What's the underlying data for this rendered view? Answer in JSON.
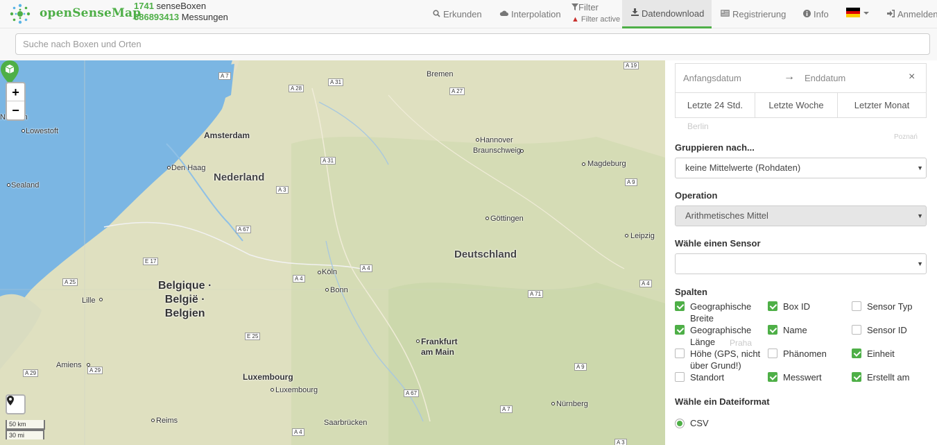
{
  "brand": {
    "name": "openSenseMap"
  },
  "stats": {
    "boxes_count": "1741",
    "boxes_label": "senseBoxen",
    "measurements_count": "886893413",
    "measurements_label": "Messungen"
  },
  "nav": {
    "explore": "Erkunden",
    "interpolation": "Interpolation",
    "filter": "Filter",
    "filter_status": "Filter active",
    "download": "Datendownload",
    "register": "Registrierung",
    "info": "Info",
    "login": "Anmelden"
  },
  "search": {
    "placeholder": "Suche nach Boxen und Orten"
  },
  "map": {
    "places": {
      "bremen": "Bremen",
      "hannover": "Hannover",
      "braunschweig": "Braunschweig",
      "magdeburg": "Magdeburg",
      "amsterdam": "Amsterdam",
      "den_haag": "Den Haag",
      "lowestoft": "Lowestoft",
      "norwich": "Norwich",
      "sealand": "Sealand",
      "goettingen": "Göttingen",
      "leipzig": "Leipzig",
      "koeln": "Köln",
      "bonn": "Bonn",
      "lille": "Lille",
      "amiens": "Amiens",
      "frankfurt_1": "Frankfurt",
      "frankfurt_2": "am Main",
      "luxembourg_country": "Luxembourg",
      "luxembourg_city": "Luxembourg",
      "nuernberg": "Nürnberg",
      "reims": "Reims",
      "saarbruecken": "Saarbrücken",
      "nederland": "Nederland",
      "deutschland": "Deutschland",
      "belgium_1": "Belgique ·",
      "belgium_2": "België ·",
      "belgium_3": "Belgien"
    },
    "roads": {
      "a7": "A 7",
      "a28": "A 28",
      "a31a": "A 31",
      "a27": "A 27",
      "a19": "A 19",
      "a31b": "A 31",
      "a3": "A 3",
      "a67": "A 67",
      "a9a": "A 9",
      "e17": "E 17",
      "a25": "A 25",
      "a4a": "A 4",
      "a4b": "A 4",
      "a71": "A 71",
      "a4c": "A 4",
      "e25": "E 25",
      "a29a": "A 29",
      "a29b": "A 29",
      "a67b": "A 67",
      "a9b": "A 9",
      "a7b": "A 7",
      "a4d": "A 4",
      "a3b": "A 3"
    },
    "zoom_in": "+",
    "zoom_out": "−",
    "scale_metric": "50 km",
    "scale_imperial": "30 mi"
  },
  "panel": {
    "start_date_placeholder": "Anfangsdatum",
    "end_date_placeholder": "Enddatum",
    "arrow": "→",
    "close": "×",
    "quick": [
      "Letzte 24 Std.",
      "Letzte Woche",
      "Letzter Monat"
    ],
    "group_label": "Gruppieren nach...",
    "group_value": "keine Mittelwerte (Rohdaten)",
    "operation_label": "Operation",
    "operation_value": "Arithmetisches Mittel",
    "sensor_label": "Wähle einen Sensor",
    "sensor_value": "",
    "columns_label": "Spalten",
    "columns": [
      {
        "label": "Geographische Breite",
        "checked": true
      },
      {
        "label": "Box ID",
        "checked": true
      },
      {
        "label": "Sensor Typ",
        "checked": false
      },
      {
        "label": "Geographische Länge",
        "checked": true
      },
      {
        "label": "Name",
        "checked": true
      },
      {
        "label": "Sensor ID",
        "checked": false
      },
      {
        "label": "Höhe (GPS, nicht über Grund!)",
        "checked": false
      },
      {
        "label": "Phänomen",
        "checked": false
      },
      {
        "label": "Einheit",
        "checked": true
      },
      {
        "label": "Standort",
        "checked": false
      },
      {
        "label": "Messwert",
        "checked": true
      },
      {
        "label": "Erstellt am",
        "checked": true
      }
    ],
    "format_label": "Wähle ein Dateiformat",
    "format_value": "CSV",
    "bg_labels": {
      "berlin": "Berlin",
      "poznan": "Poznań",
      "praha": "Praha"
    }
  },
  "colors": {
    "accent": "#4eaf47",
    "water": "#7bb6e3",
    "land": "#e8e4d0"
  }
}
